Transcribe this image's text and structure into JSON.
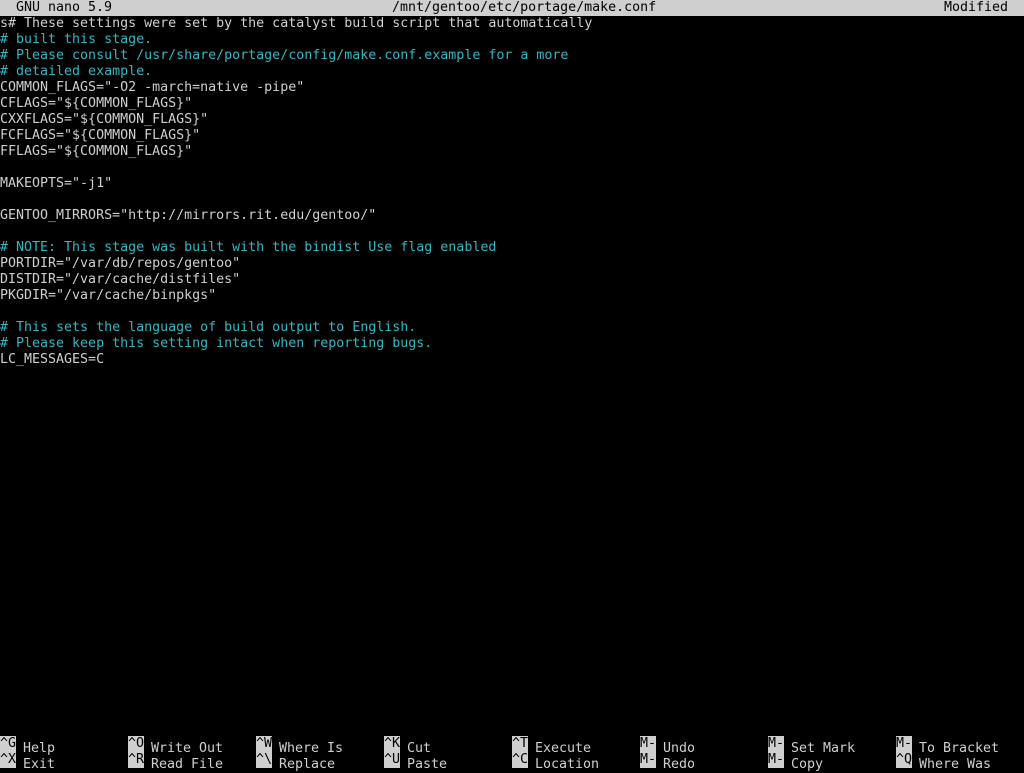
{
  "titlebar": {
    "app": "GNU nano 5.9",
    "file": "/mnt/gentoo/etc/portage/make.conf",
    "status": "Modified"
  },
  "colors": {
    "background": "#000000",
    "text": "#cfcfcf",
    "comment": "#2eb8c4",
    "bar_bg": "#cfcfcf",
    "bar_fg": "#000000"
  },
  "editor": {
    "lines": [
      {
        "text": "s# These settings were set by the catalyst build script that automatically",
        "style": "plain"
      },
      {
        "text": "# built this stage.",
        "style": "comment"
      },
      {
        "text": "# Please consult /usr/share/portage/config/make.conf.example for a more",
        "style": "comment"
      },
      {
        "text": "# detailed example.",
        "style": "comment"
      },
      {
        "text": "COMMON_FLAGS=\"-O2 -march=native -pipe\"",
        "style": "plain"
      },
      {
        "text": "CFLAGS=\"${COMMON_FLAGS}\"",
        "style": "plain"
      },
      {
        "text": "CXXFLAGS=\"${COMMON_FLAGS}\"",
        "style": "plain"
      },
      {
        "text": "FCFLAGS=\"${COMMON_FLAGS}\"",
        "style": "plain"
      },
      {
        "text": "FFLAGS=\"${COMMON_FLAGS}\"",
        "style": "plain"
      },
      {
        "text": "",
        "style": "plain"
      },
      {
        "text": "MAKEOPTS=\"-j1\"",
        "style": "plain"
      },
      {
        "text": "",
        "style": "plain"
      },
      {
        "text": "GENTOO_MIRRORS=\"http://mirrors.rit.edu/gentoo/\"",
        "style": "plain"
      },
      {
        "text": "",
        "style": "plain"
      },
      {
        "text": "# NOTE: This stage was built with the bindist Use flag enabled",
        "style": "comment"
      },
      {
        "text": "PORTDIR=\"/var/db/repos/gentoo\"",
        "style": "plain"
      },
      {
        "text": "DISTDIR=\"/var/cache/distfiles\"",
        "style": "plain"
      },
      {
        "text": "PKGDIR=\"/var/cache/binpkgs\"",
        "style": "plain"
      },
      {
        "text": "",
        "style": "plain"
      },
      {
        "text": "# This sets the language of build output to English.",
        "style": "comment"
      },
      {
        "text": "# Please keep this setting intact when reporting bugs.",
        "style": "comment"
      },
      {
        "text": "LC_MESSAGES=C",
        "style": "plain"
      }
    ]
  },
  "shortcuts": {
    "row1": [
      {
        "key": "^G",
        "label": "Help"
      },
      {
        "key": "^O",
        "label": "Write Out"
      },
      {
        "key": "^W",
        "label": "Where Is"
      },
      {
        "key": "^K",
        "label": "Cut"
      },
      {
        "key": "^T",
        "label": "Execute"
      },
      {
        "key": "M-U",
        "label": "Undo"
      },
      {
        "key": "M-A",
        "label": "Set Mark"
      },
      {
        "key": "M-]",
        "label": "To Bracket"
      }
    ],
    "row2": [
      {
        "key": "^X",
        "label": "Exit"
      },
      {
        "key": "^R",
        "label": "Read File"
      },
      {
        "key": "^\\",
        "label": "Replace"
      },
      {
        "key": "^U",
        "label": "Paste"
      },
      {
        "key": "^C",
        "label": "Location"
      },
      {
        "key": "M-E",
        "label": "Redo"
      },
      {
        "key": "M-6",
        "label": "Copy"
      },
      {
        "key": "^Q",
        "label": "Where Was"
      }
    ]
  }
}
